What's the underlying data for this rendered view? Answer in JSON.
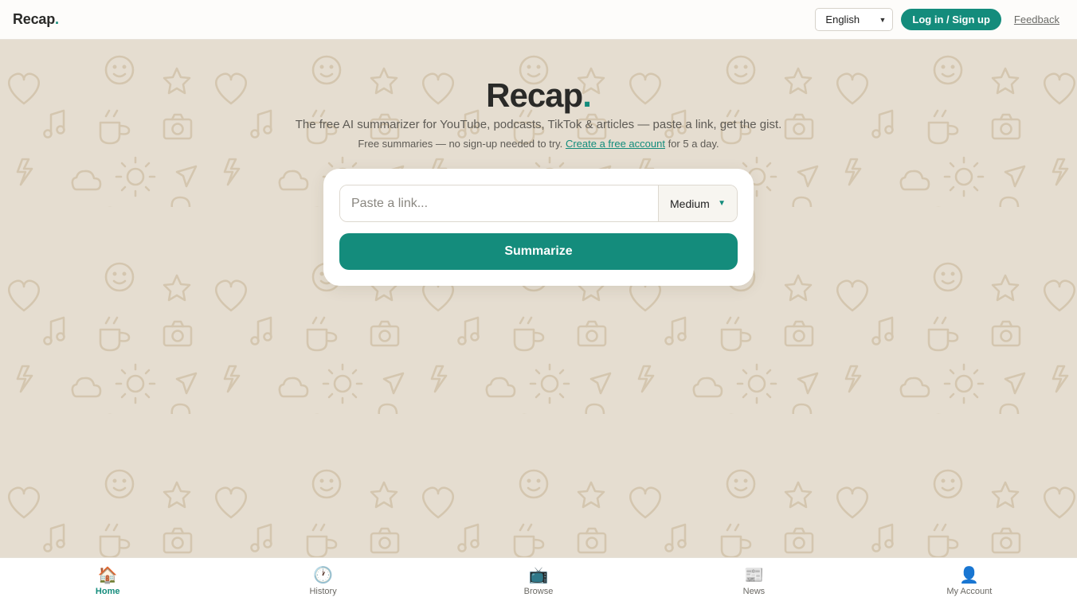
{
  "header": {
    "logo_text": "Recap",
    "logo_dot": ".",
    "language": "English",
    "login_label": "Log in / Sign up",
    "feedback_label": "Feedback"
  },
  "hero": {
    "title": "Recap",
    "title_dot": ".",
    "subtitle": "The free AI summarizer for YouTube, podcasts, TikTok & articles — paste a link, get the gist.",
    "note_prefix": "Free summaries — no sign-up needed to try.",
    "note_link": "Create a free account",
    "note_suffix": "for 5 a day."
  },
  "form": {
    "input_placeholder": "Paste a link...",
    "length_value": "Medium",
    "submit_label": "Summarize"
  },
  "nav": {
    "items": [
      {
        "label": "Home",
        "icon": "home-icon",
        "glyph": "🏠",
        "active": true
      },
      {
        "label": "History",
        "icon": "clock-icon",
        "glyph": "🕐",
        "active": false
      },
      {
        "label": "Browse",
        "icon": "tv-icon",
        "glyph": "📺",
        "active": false
      },
      {
        "label": "News",
        "icon": "newspaper-icon",
        "glyph": "📰",
        "active": false
      },
      {
        "label": "My Account",
        "icon": "user-icon",
        "glyph": "👤",
        "active": false
      }
    ]
  },
  "theme": {
    "accent": "#148c7c",
    "background": "#e5ddd0",
    "doodle_stroke": "#d4c6af"
  }
}
